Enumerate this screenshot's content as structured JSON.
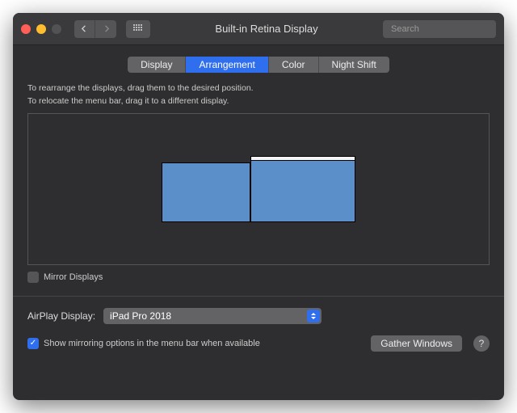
{
  "titlebar": {
    "title": "Built-in Retina Display",
    "search_placeholder": "Search"
  },
  "tabs": [
    {
      "label": "Display",
      "active": false
    },
    {
      "label": "Arrangement",
      "active": true
    },
    {
      "label": "Color",
      "active": false
    },
    {
      "label": "Night Shift",
      "active": false
    }
  ],
  "instructions": {
    "line1": "To rearrange the displays, drag them to the desired position.",
    "line2": "To relocate the menu bar, drag it to a different display."
  },
  "mirror": {
    "label": "Mirror Displays",
    "checked": false
  },
  "airplay": {
    "label": "AirPlay Display:",
    "selected": "iPad Pro 2018"
  },
  "show_mirroring": {
    "label": "Show mirroring options in the menu bar when available",
    "checked": true
  },
  "gather_button": "Gather Windows",
  "help_label": "?"
}
